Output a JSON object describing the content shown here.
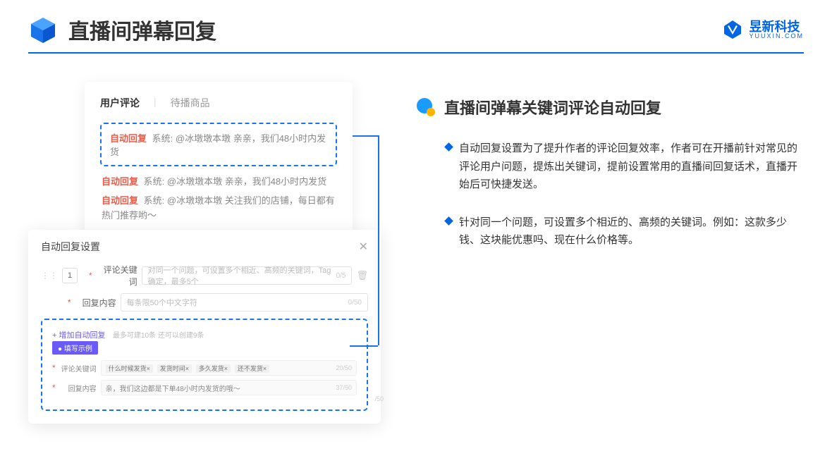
{
  "header": {
    "title": "直播间弹幕回复",
    "brand_cn": "昱新科技",
    "brand_en": "YUUXIN.COM"
  },
  "comments_card": {
    "tab_active": "用户评论",
    "tab_inactive": "待播商品",
    "highlighted": {
      "tag": "自动回复",
      "sys": "系统:",
      "text": "@冰墩墩本墩 亲亲，我们48小时内发货"
    },
    "lines": [
      {
        "tag": "自动回复",
        "sys": "系统:",
        "text": "@冰墩墩本墩 亲亲，我们48小时内发货"
      },
      {
        "tag": "自动回复",
        "sys": "系统:",
        "text": "@冰墩墩本墩 关注我们的店铺，每日都有热门推荐哟～"
      }
    ]
  },
  "dialog": {
    "title": "自动回复设置",
    "num": "1",
    "kw_label": "评论关键词",
    "kw_placeholder": "对同一个问题，可设置多个相近、高频的关键词，Tag确定，最多5个",
    "kw_counter": "0/5",
    "reply_label": "回复内容",
    "reply_placeholder": "每条限50个中文字符",
    "reply_counter": "0/50",
    "add_link": "+ 增加自动回复",
    "add_hint": "最多可建10条 还可以创建9条",
    "badge": "● 填写示例",
    "ex_kw_label": "评论关键词",
    "ex_chips": [
      "什么时候发货×",
      "发货时间×",
      "多久发货×",
      "还不发货×"
    ],
    "ex_kw_counter": "20/50",
    "ex_reply_label": "回复内容",
    "ex_reply_text": "亲，我们这边都是下单48小时内发货的哦～",
    "ex_reply_counter": "37/50",
    "outer_counter": "/50"
  },
  "right": {
    "title": "直播间弹幕关键词评论自动回复",
    "bullets": [
      "自动回复设置为了提升作者的评论回复效率，作者可在开播前针对常见的评论用户问题，提炼出关键词，提前设置常用的直播间回复话术，直播开始后可快捷发送。",
      "针对同一个问题，可设置多个相近的、高频的关键词。例如：这款多少钱、这块能优惠吗、现在什么价格等。"
    ]
  }
}
